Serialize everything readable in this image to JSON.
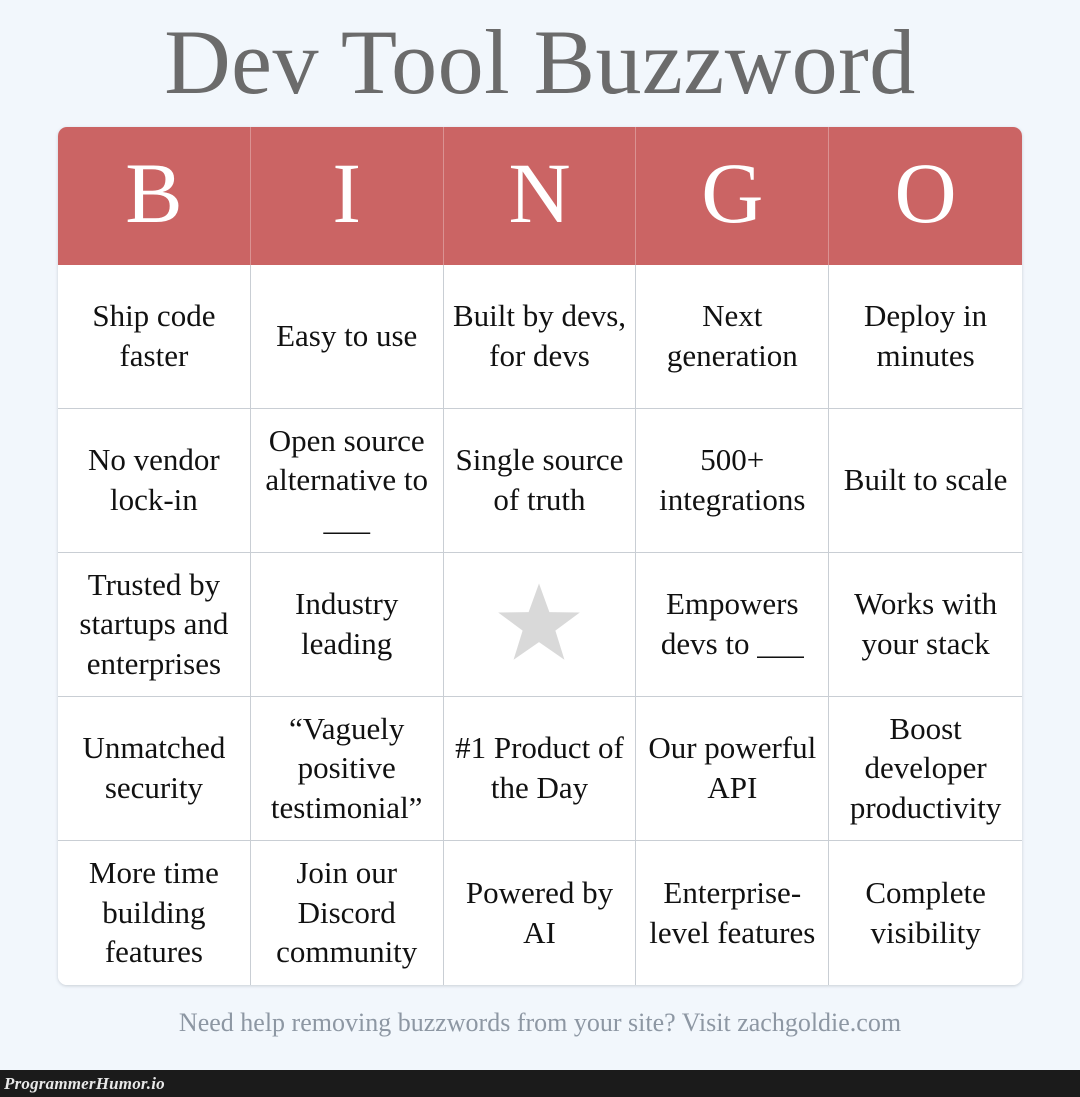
{
  "title": "Dev Tool Buzzword",
  "colors": {
    "page_background": "#f2f7fc",
    "header_red": "#cb6464",
    "title_gray": "#6b6b6b",
    "cell_border": "#c9ced4",
    "free_space_star": "#d9d9d9",
    "footer_gray": "#8d97a3",
    "watermark_bar": "#1b1b1b"
  },
  "header": {
    "letters": [
      "B",
      "I",
      "N",
      "G",
      "O"
    ]
  },
  "card": {
    "columns": [
      "B",
      "I",
      "N",
      "G",
      "O"
    ],
    "rows": [
      [
        "Ship code faster",
        "Easy to use",
        "Built by devs, for devs",
        "Next generation",
        "Deploy in minutes"
      ],
      [
        "No vendor lock-in",
        "Open source alternative to ___",
        "Single source of truth",
        "500+ integrations",
        "Built to scale"
      ],
      [
        "Trusted by startups and enterprises",
        "Industry leading",
        "",
        "Empowers devs to ___",
        "Works with your stack"
      ],
      [
        "Unmatched security",
        "“Vaguely positive testimonial”",
        "#1 Product of the Day",
        "Our powerful API",
        "Boost developer productivity"
      ],
      [
        "More time building features",
        "Join our Discord community",
        "Powered by AI",
        "Enterprise-level features",
        "Complete visibility"
      ]
    ],
    "free_space": {
      "row": 2,
      "col": 2,
      "icon": "star-icon"
    }
  },
  "footer": {
    "note": "Need help removing buzzwords from your site? Visit zachgoldie.com"
  },
  "watermark": {
    "text": "ProgrammerHumor.io"
  }
}
